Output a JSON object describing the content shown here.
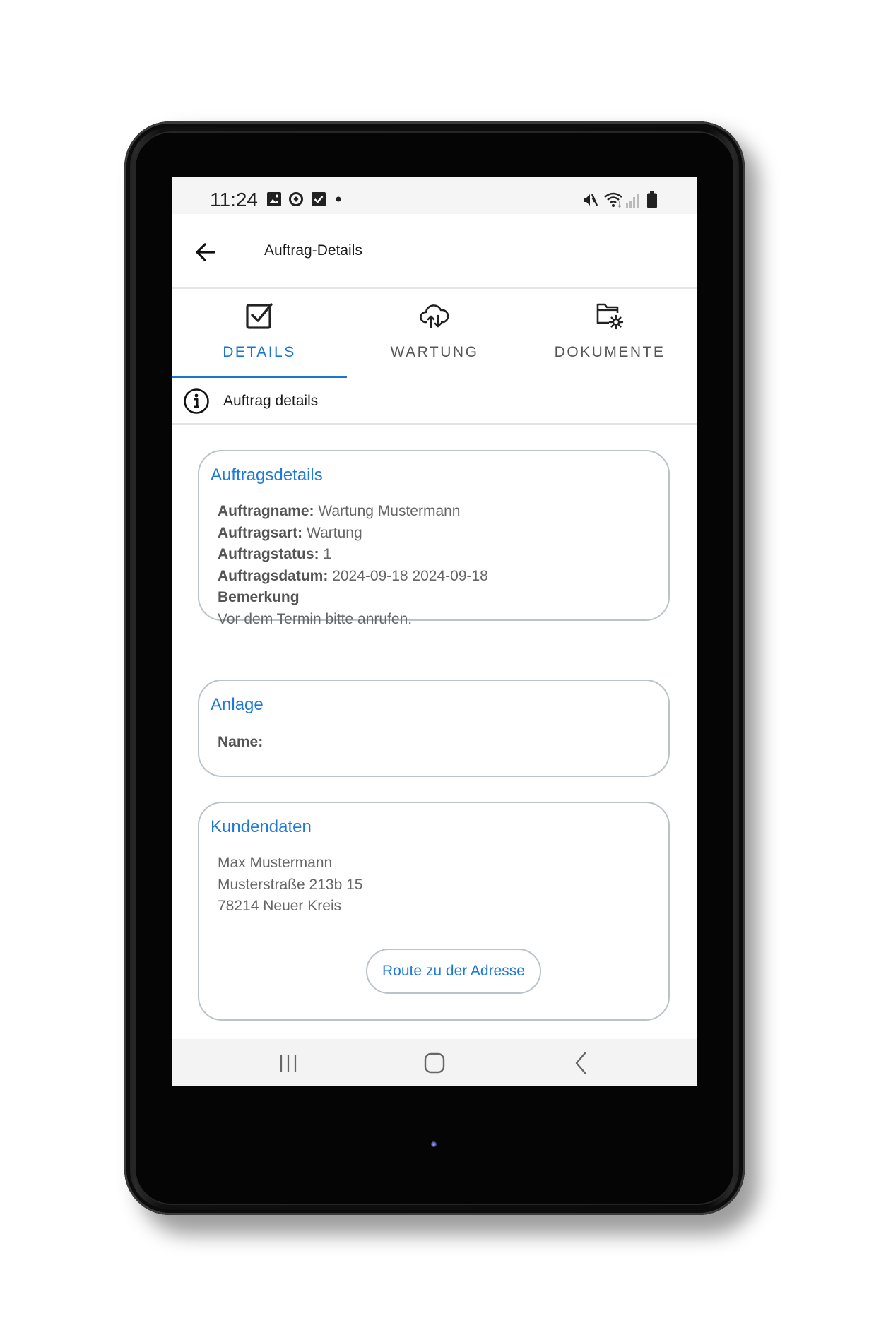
{
  "status_bar": {
    "time": "11:24",
    "left_icons": [
      "gallery-icon",
      "sync-icon",
      "checkbox-icon",
      "dot-icon"
    ],
    "right_icons": [
      "mute-icon",
      "wifi-icon",
      "signal-icon",
      "battery-icon"
    ]
  },
  "app_bar": {
    "title": "Auftrag-Details",
    "back_icon": "arrow-left-icon"
  },
  "tabs": [
    {
      "label": "DETAILS",
      "icon": "checkbox-icon",
      "active": true
    },
    {
      "label": "WARTUNG",
      "icon": "cloud-sync-icon",
      "active": false
    },
    {
      "label": "DOKUMENTE",
      "icon": "folder-settings-icon",
      "active": false
    }
  ],
  "section": {
    "title": "Auftrag details",
    "icon": "info-icon"
  },
  "order_card": {
    "title": "Auftragsdetails",
    "name_label": "Auftragname:",
    "name_value": "Wartung Mustermann",
    "type_label": "Auftragsart:",
    "type_value": "Wartung",
    "status_label": "Auftragstatus:",
    "status_value": "1",
    "date_label": "Auftragsdatum:",
    "date_value": "2024-09-18 2024-09-18",
    "remark_label": "Bemerkung",
    "remark_value": "Vor dem Termin bitte anrufen."
  },
  "plant_card": {
    "title": "Anlage",
    "name_label": "Name:"
  },
  "customer_card": {
    "title": "Kundendaten",
    "name": "Max Mustermann",
    "street": "Musterstraße 213b 15",
    "city": "78214 Neuer Kreis",
    "route_button": "Route zu der Adresse"
  },
  "nav_bar": {
    "icons": [
      "recent-apps-icon",
      "home-icon",
      "back-icon"
    ]
  },
  "colors": {
    "accent": "#1976d2",
    "card_title": "#1e7ad8",
    "card_border": "#b9c3c9"
  }
}
